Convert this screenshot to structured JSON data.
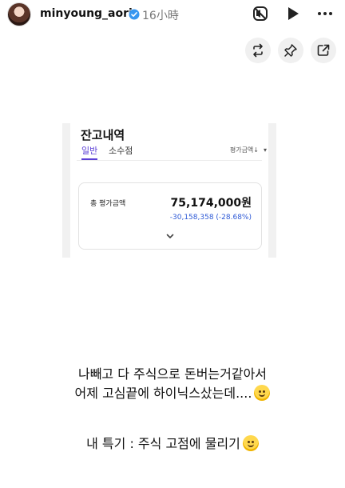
{
  "header": {
    "username": "minyoung_aori",
    "time": "16小時",
    "icons": [
      "avatar",
      "verified-badge-icon",
      "mute-icon",
      "play-icon",
      "more-icon"
    ]
  },
  "actions": {
    "icons": [
      "repost-icon",
      "pin-icon",
      "share-icon"
    ]
  },
  "screenshot": {
    "title": "잔고내역",
    "tabs": [
      {
        "label": "일반",
        "active": true
      },
      {
        "label": "소수점",
        "active": false
      }
    ],
    "sort_label": "평가금액↓",
    "sort_caret": "▾",
    "card": {
      "label": "총 평가금액",
      "amount": "75,174,000원",
      "change": "-30,158,358 (-28.68%)"
    },
    "accent_color": "#5b3fd6",
    "change_color": "#2d59d6"
  },
  "captions": {
    "line1": "나빼고 다 주식으로 돈버는거같아서",
    "line2": "어제 고심끝에 하이닉스샀는데....",
    "line3": "내 특기 : 주식 고점에 물리기"
  }
}
